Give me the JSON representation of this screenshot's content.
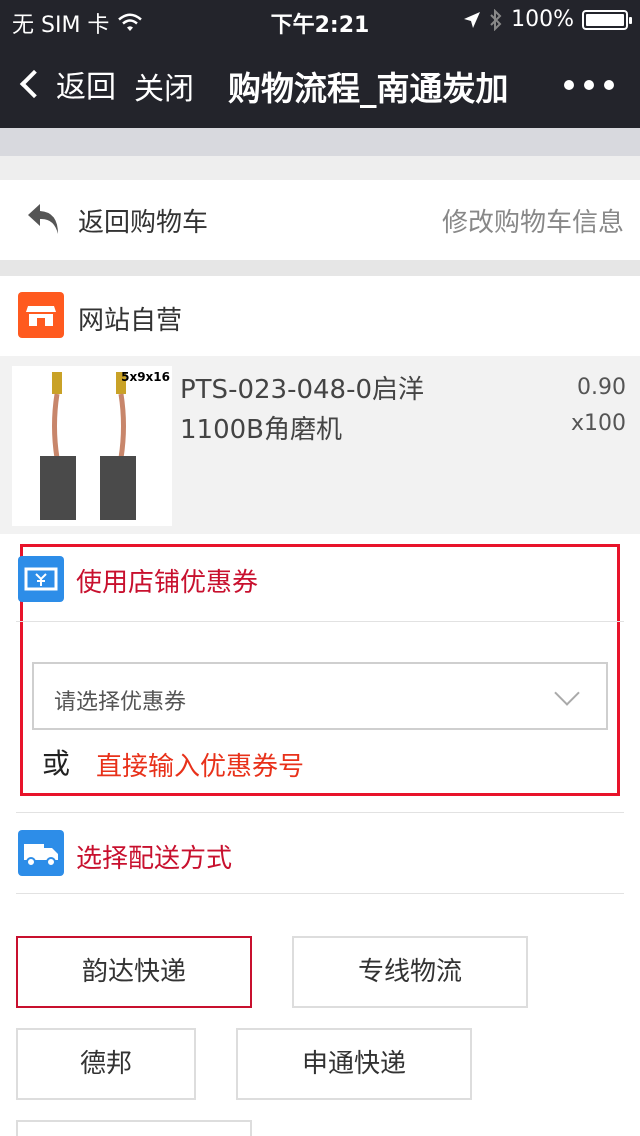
{
  "status_bar": {
    "carrier": "无 SIM 卡",
    "time": "下午2:21",
    "battery": "100%"
  },
  "navbar": {
    "back_label": "返回",
    "close_label": "关闭",
    "title": "购物流程_南通炭加"
  },
  "cart": {
    "back_label": "返回购物车",
    "edit_label": "修改购物车信息"
  },
  "store": {
    "name": "网站自营"
  },
  "product": {
    "name": "PTS-023-048-0启洋1100B角磨机",
    "price": "0.90",
    "quantity": "x100",
    "image_size_label": "5x9x16"
  },
  "coupon": {
    "header": "使用店铺优惠券",
    "select_placeholder": "请选择优惠券",
    "or_label": "或",
    "input_link": "直接输入优惠券号"
  },
  "shipping": {
    "header": "选择配送方式",
    "options": [
      {
        "label": "韵达快递",
        "selected": true
      },
      {
        "label": "专线物流",
        "selected": false
      },
      {
        "label": "德邦",
        "selected": false
      },
      {
        "label": "申通快递",
        "selected": false
      },
      {
        "label": "",
        "selected": false
      }
    ]
  },
  "colors": {
    "nav_bg": "#23242b",
    "accent_red": "#c8102e",
    "link_orange": "#e8311a",
    "coupon_border": "#e8132a",
    "store_icon": "#ff5a1f",
    "section_icon": "#2d8de8"
  },
  "icons": {
    "back": "reply-arrow-icon",
    "store": "store-icon",
    "coupon": "coupon-ticket-icon",
    "shipping": "delivery-truck-icon"
  }
}
